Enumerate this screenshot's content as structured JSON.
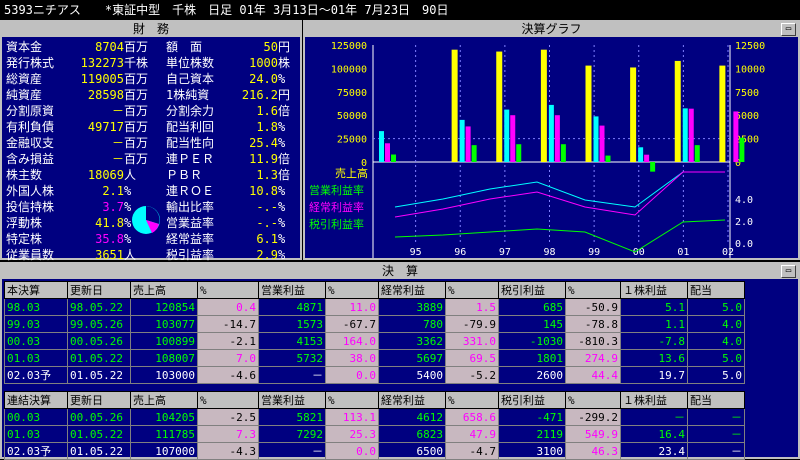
{
  "title": "5393ニチアス　　*東証中型　千株　日足 01年 3月13日～01年 7月23日　90日",
  "finance": {
    "header": "財　務",
    "left": [
      {
        "label": "資本金",
        "value": "8704",
        "unit": "百万"
      },
      {
        "label": "発行株式",
        "value": "132273",
        "unit": "千株"
      },
      {
        "label": "総資産",
        "value": "119005",
        "unit": "百万"
      },
      {
        "label": "純資産",
        "value": "28598",
        "unit": "百万"
      },
      {
        "label": "分割原資",
        "value": "－",
        "unit": "百万"
      },
      {
        "label": "有利負債",
        "value": "49717",
        "unit": "百万"
      },
      {
        "label": "金融収支",
        "value": "－",
        "unit": "百万"
      },
      {
        "label": "含み損益",
        "value": "－",
        "unit": "百万"
      },
      {
        "label": "株主数",
        "value": "18069",
        "unit": "人"
      },
      {
        "label": "外国人株",
        "value": "2.1",
        "unit": "%"
      },
      {
        "label": "投信持株",
        "value": "3.7",
        "unit": "%"
      },
      {
        "label": "浮動株",
        "value": "41.8",
        "unit": "%"
      },
      {
        "label": "特定株",
        "value": "35.8",
        "unit": "%"
      },
      {
        "label": "従業員数",
        "value": "3651",
        "unit": "人"
      }
    ],
    "right": [
      {
        "label": "額　面",
        "value": "50",
        "unit": "円"
      },
      {
        "label": "単位株数",
        "value": "1000",
        "unit": "株"
      },
      {
        "label": "自己資本",
        "value": "24.0",
        "unit": "%"
      },
      {
        "label": "1株純資",
        "value": "216.2",
        "unit": "円"
      },
      {
        "label": "分割余力",
        "value": "1.6",
        "unit": "倍"
      },
      {
        "label": "配当利回",
        "value": "1.8",
        "unit": "%"
      },
      {
        "label": "配当性向",
        "value": "25.4",
        "unit": "%"
      },
      {
        "label": "連ＰＥＲ",
        "value": "11.9",
        "unit": "倍"
      },
      {
        "label": "ＰＢＲ",
        "value": "1.3",
        "unit": "倍"
      },
      {
        "label": "連ＲＯＥ",
        "value": "10.8",
        "unit": "%"
      },
      {
        "label": "輸出比率",
        "value": "-.-",
        "unit": "%"
      },
      {
        "label": "営業益率",
        "value": "-.-",
        "unit": "%"
      },
      {
        "label": "経常益率",
        "value": "6.1",
        "unit": "%"
      },
      {
        "label": "税引益率",
        "value": "2.9",
        "unit": "%"
      }
    ],
    "pie_colors": [
      "#00ffff",
      "#ff00ff",
      "#00ffff",
      "#ff00ff"
    ]
  },
  "chart_header": "決算グラフ",
  "chart_data": {
    "type": "bar",
    "categories": [
      "95",
      "96",
      "97",
      "98",
      "99",
      "00",
      "01",
      "02"
    ],
    "left_axis_ticks": [
      "125000",
      "100000",
      "75000",
      "50000",
      "25000",
      "0"
    ],
    "right_axis_ticks": [
      "12500",
      "10000",
      "7500",
      "5000",
      "2500",
      "0"
    ],
    "series": [
      {
        "name": "売上高",
        "color": "#ffff00",
        "values": [
          null,
          120000,
          118000,
          120000,
          103000,
          101000,
          108000,
          103000
        ]
      },
      {
        "name": "営業利益率",
        "color": "#00ffff",
        "values": [
          3300,
          4500,
          5600,
          6100,
          4871,
          1573,
          5732,
          null
        ]
      },
      {
        "name": "経常利益率",
        "color": "#ff00ff",
        "values": [
          2000,
          3800,
          5000,
          5000,
          3889,
          780,
          5697,
          5400
        ]
      },
      {
        "name": "税引利益率",
        "color": "#00ff00",
        "values": [
          800,
          1800,
          1900,
          1900,
          685,
          -1030,
          1801,
          2600
        ]
      }
    ],
    "ratio_labels": [
      "4.0",
      "2.0",
      "0.0"
    ],
    "legend": [
      "売上高",
      "営業利益率",
      "経常利益率",
      "税引利益率"
    ]
  },
  "kessan": {
    "header": "決　算",
    "columns": [
      "本決算",
      "更新日",
      "売上高",
      "%",
      "営業利益",
      "%",
      "経常利益",
      "%",
      "税引利益",
      "%",
      "１株利益",
      "配当"
    ],
    "rows": [
      [
        "98.03",
        "98.05.22",
        "120854",
        "0.4",
        "4871",
        "11.0",
        "3889",
        "1.5",
        "685",
        "-50.9",
        "5.1",
        "5.0"
      ],
      [
        "99.03",
        "99.05.26",
        "103077",
        "-14.7",
        "1573",
        "-67.7",
        "780",
        "-79.9",
        "145",
        "-78.8",
        "1.1",
        "4.0"
      ],
      [
        "00.03",
        "00.05.26",
        "100899",
        "-2.1",
        "4153",
        "164.0",
        "3362",
        "331.0",
        "-1030",
        "-810.3",
        "-7.8",
        "4.0"
      ],
      [
        "01.03",
        "01.05.22",
        "108007",
        "7.0",
        "5732",
        "38.0",
        "5697",
        "69.5",
        "1801",
        "274.9",
        "13.6",
        "5.0"
      ],
      [
        "02.03予",
        "01.05.22",
        "103000",
        "-4.6",
        "－",
        "0.0",
        "5400",
        "-5.2",
        "2600",
        "44.4",
        "19.7",
        "5.0"
      ]
    ],
    "columns2": [
      "連結決算",
      "更新日",
      "売上高",
      "%",
      "営業利益",
      "%",
      "経常利益",
      "%",
      "税引利益",
      "%",
      "１株利益",
      "配当"
    ],
    "rows2": [
      [
        "00.03",
        "00.05.26",
        "104205",
        "-2.5",
        "5821",
        "113.1",
        "4612",
        "658.6",
        "-471",
        "-299.2",
        "－",
        "－"
      ],
      [
        "01.03",
        "01.05.22",
        "111785",
        "7.3",
        "7292",
        "25.3",
        "6823",
        "47.9",
        "2119",
        "549.9",
        "16.4",
        "－"
      ],
      [
        "02.03予",
        "01.05.22",
        "107000",
        "-4.3",
        "－",
        "0.0",
        "6500",
        "-4.7",
        "3100",
        "46.3",
        "23.4",
        "－"
      ]
    ]
  }
}
